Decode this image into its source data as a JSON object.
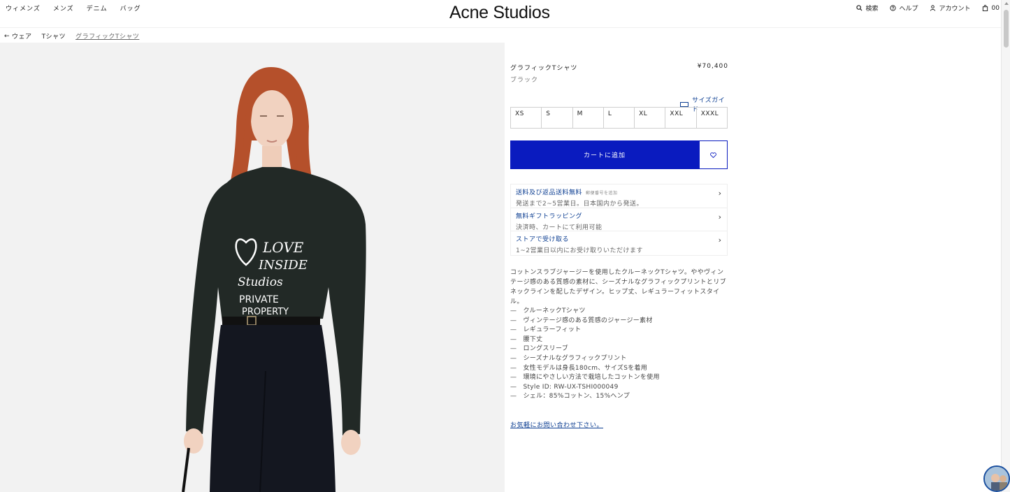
{
  "header": {
    "nav": [
      "ウィメンズ",
      "メンズ",
      "デニム",
      "バッグ"
    ],
    "logo": "Acne Studios",
    "search_label": "検索",
    "help_label": "ヘルプ",
    "account_label": "アカウント",
    "cart_count": "00"
  },
  "breadcrumb": {
    "back_label": "ウェア",
    "items": [
      "Tシャツ",
      "グラフィックTシャツ"
    ]
  },
  "product": {
    "name": "グラフィックTシャツ",
    "price": "¥70,400",
    "color": "ブラック",
    "size_guide_label": "サイズガイド",
    "sizes": [
      "XS",
      "S",
      "M",
      "L",
      "XL",
      "XXL",
      "XXXL"
    ],
    "add_to_cart": "カートに追加",
    "info": [
      {
        "title": "送料及び返品送料無料",
        "small": "郵便番号を追加",
        "sub": "発送まで2~5営業日。日本国内から発送。"
      },
      {
        "title": "無料ギフトラッピング",
        "small": "",
        "sub": "決済時、カートにて利用可能"
      },
      {
        "title": "ストアで受け取る",
        "small": "",
        "sub": "1~2営業日以内にお受け取りいただけます"
      }
    ],
    "description": "コットンスラブジャージーを使用したクルーネックTシャツ。ややヴィンテージ感のある質感の素材に、シーズナルなグラフィックプリントとリブネックラインを配したデザイン。ヒップ丈、レギュラーフィットスタイル。",
    "features": [
      "クルーネックTシャツ",
      "ヴィンテージ感のある質感のジャージー素材",
      "レギュラーフィット",
      "腰下丈",
      "ロングスリーブ",
      "シーズナルなグラフィックプリント",
      "女性モデルは身長180cm、サイズSを着用",
      "環境にやさしい方法で栽培したコットンを使用",
      "Style ID: RW-UX-TSHI000049",
      "シェル：85%コットン、15%ヘンプ"
    ],
    "contact_label": "お気軽にお問い合わせ下さい。"
  },
  "image": {
    "print_lines": [
      "LOVE",
      "INSIDE",
      "Studios",
      "PRIVATE",
      "PROPERTY"
    ]
  }
}
